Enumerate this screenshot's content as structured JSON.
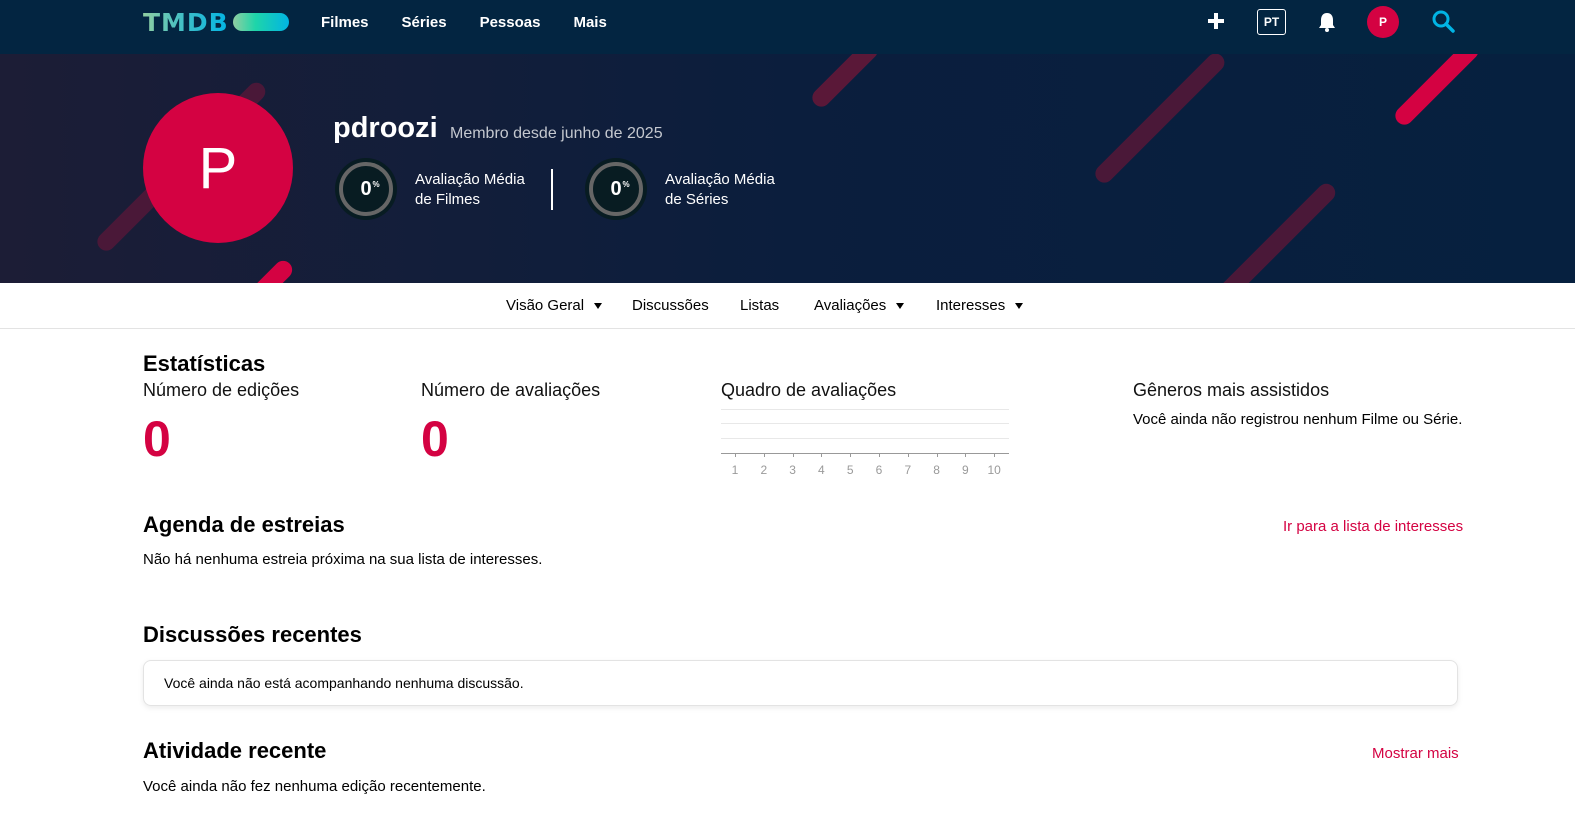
{
  "nav": {
    "logo_text": "TMDB",
    "links": [
      "Filmes",
      "Séries",
      "Pessoas",
      "Mais"
    ],
    "lang": "PT",
    "avatar_initial": "P"
  },
  "profile": {
    "username": "pdroozi",
    "member_since": "Membro desde junho de 2025",
    "avatar_initial": "P",
    "scores": [
      {
        "value": "0",
        "unit": "%",
        "label_line1": "Avaliação Média",
        "label_line2": "de Filmes"
      },
      {
        "value": "0",
        "unit": "%",
        "label_line1": "Avaliação Média",
        "label_line2": "de Séries"
      }
    ]
  },
  "subnav": {
    "items": [
      "Visão Geral",
      "Discussões",
      "Listas",
      "Avaliações",
      "Interesses"
    ]
  },
  "stats": {
    "title": "Estatísticas",
    "edits_label": "Número de edições",
    "edits_value": "0",
    "ratings_label": "Número de avaliações",
    "ratings_value": "0",
    "chart_label": "Quadro de avaliações",
    "genres_label": "Gêneros mais assistidos",
    "genres_empty": "Você ainda não registrou nenhum Filme ou Série."
  },
  "chart_data": {
    "type": "bar",
    "categories": [
      "1",
      "2",
      "3",
      "4",
      "5",
      "6",
      "7",
      "8",
      "9",
      "10"
    ],
    "values": [
      0,
      0,
      0,
      0,
      0,
      0,
      0,
      0,
      0,
      0
    ],
    "title": "Quadro de avaliações",
    "xlabel": "",
    "ylabel": "",
    "grid": true
  },
  "upcoming": {
    "title": "Agenda de estreias",
    "link": "Ir para a lista de interesses",
    "empty": "Não há nenhuma estreia próxima na sua lista de interesses."
  },
  "discussions": {
    "title": "Discussões recentes",
    "empty": "Você ainda não está acompanhando nenhuma discussão."
  },
  "activity": {
    "title": "Atividade recente",
    "link": "Mostrar mais",
    "empty": "Você ainda não fez nenhuma edição recentemente."
  },
  "colors": {
    "nav_bg": "#032541",
    "accent": "#d40242",
    "logo_gradient_start": "#90cea1",
    "logo_gradient_end": "#01b4e4"
  }
}
